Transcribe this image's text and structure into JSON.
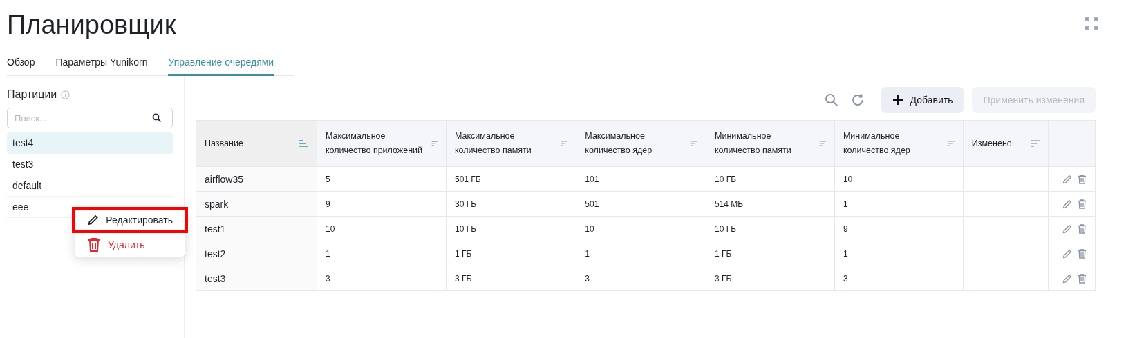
{
  "page": {
    "title": "Планировщик"
  },
  "tabs": [
    {
      "label": "Обзор",
      "selected": false
    },
    {
      "label": "Параметры Yunikorn",
      "selected": false
    },
    {
      "label": "Управление очередями",
      "selected": true
    }
  ],
  "sidebar": {
    "title": "Партиции",
    "search": {
      "placeholder": "Поиск..."
    },
    "items": [
      {
        "label": "test4",
        "selected": true
      },
      {
        "label": "test3",
        "selected": false
      },
      {
        "label": "default",
        "selected": false
      },
      {
        "label": "eee",
        "selected": false
      }
    ]
  },
  "context_menu": {
    "items": [
      {
        "label": "Редактировать",
        "kind": "edit",
        "highlighted": true
      },
      {
        "label": "Удалить",
        "kind": "delete",
        "highlighted": false
      }
    ]
  },
  "toolbar": {
    "buttons": [
      {
        "label": "Добавить",
        "kind": "add",
        "disabled": false
      },
      {
        "label": "Применить изменения",
        "kind": "apply",
        "disabled": true
      }
    ]
  },
  "table": {
    "columns": [
      {
        "label": "Название",
        "sorted": true
      },
      {
        "label": "Максимальное количество приложений",
        "sorted": false
      },
      {
        "label": "Максимальное количество памяти",
        "sorted": false
      },
      {
        "label": "Максимальное количество ядер",
        "sorted": false
      },
      {
        "label": "Минимальное количество памяти",
        "sorted": false
      },
      {
        "label": "Минимальное количество ядер",
        "sorted": false
      },
      {
        "label": "Изменено",
        "sorted": false
      }
    ],
    "rows": [
      [
        "airflow35",
        "5",
        "501 ГБ",
        "101",
        "10 ГБ",
        "10",
        ""
      ],
      [
        "spark",
        "9",
        "30 ГБ",
        "501",
        "514 МБ",
        "1",
        ""
      ],
      [
        "test1",
        "10",
        "10 ГБ",
        "10",
        "10 ГБ",
        "9",
        ""
      ],
      [
        "test2",
        "1",
        "1 ГБ",
        "1",
        "1 ГБ",
        "1",
        ""
      ],
      [
        "test3",
        "3",
        "3 ГБ",
        "3",
        "3 ГБ",
        "3",
        ""
      ]
    ]
  }
}
